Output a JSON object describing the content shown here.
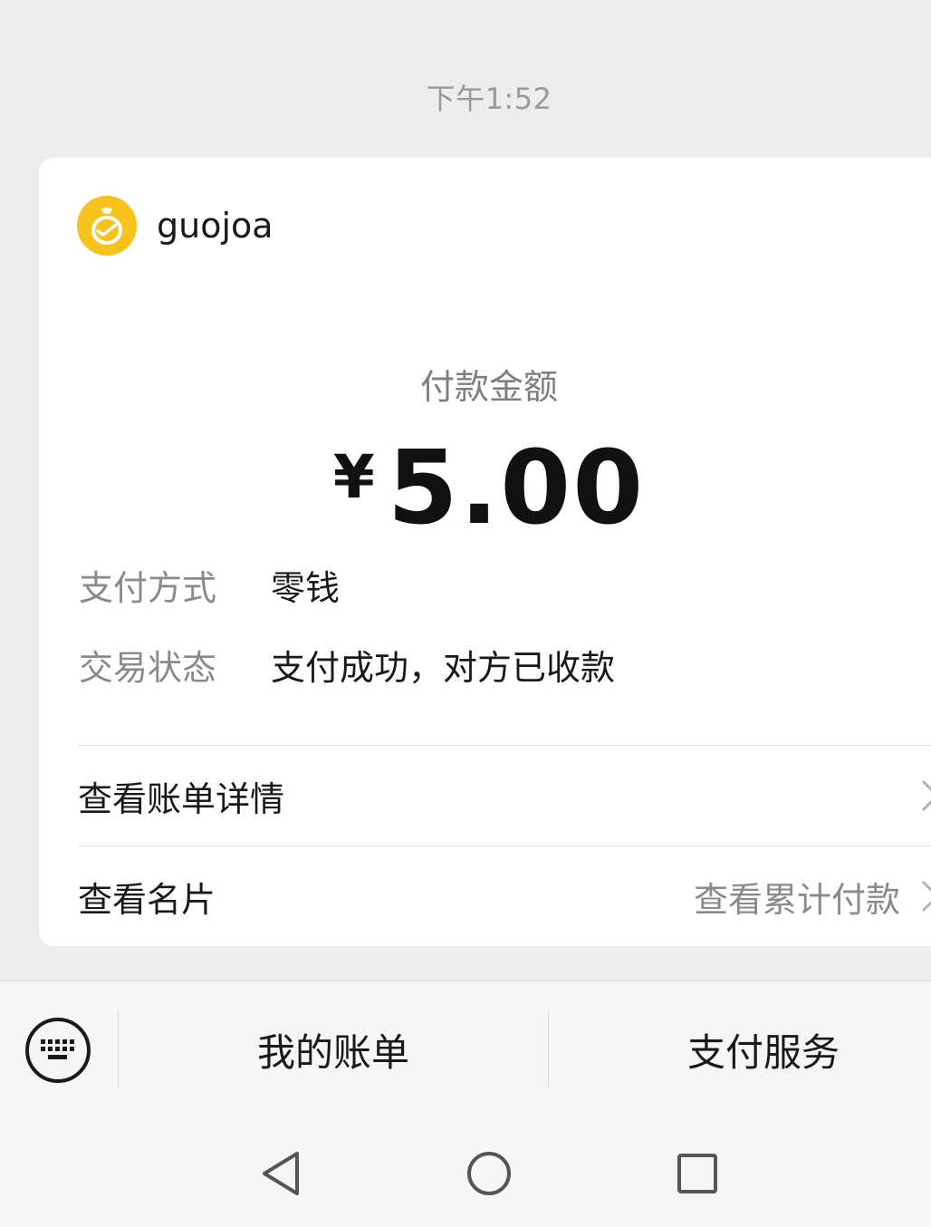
{
  "timestamp": "下午1:52",
  "merchant": {
    "name": "guojoa",
    "logo_icon": "yellow-bag-icon",
    "logo_color": "#f8c21c"
  },
  "payment": {
    "amount_label": "付款金额",
    "currency": "¥",
    "amount": "5.00"
  },
  "details": [
    {
      "key": "支付方式",
      "value": "零钱"
    },
    {
      "key": "交易状态",
      "value": "支付成功，对方已收款"
    }
  ],
  "links": {
    "bill_details": "查看账单详情",
    "view_card": "查看名片",
    "view_total": "查看累计付款"
  },
  "bottom_menu": {
    "keyboard_icon": "keyboard-icon",
    "my_bills": "我的账单",
    "pay_services": "支付服务"
  },
  "nav": {
    "back_icon": "back-triangle-icon",
    "home_icon": "home-circle-icon",
    "recent_icon": "recent-square-icon"
  }
}
